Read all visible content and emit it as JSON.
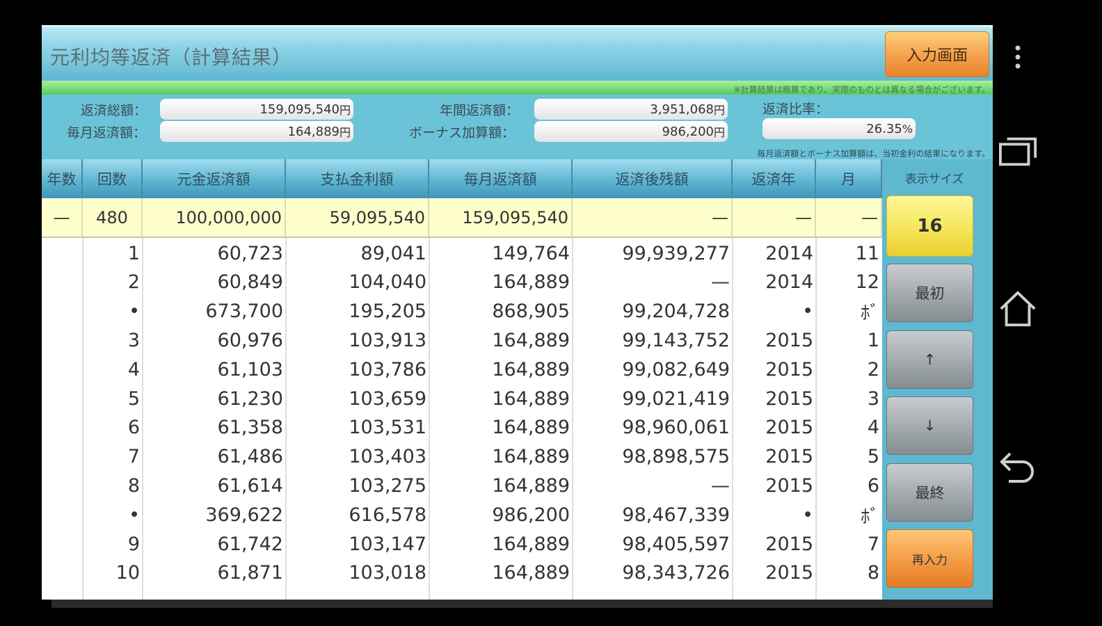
{
  "title": "元利均等返済（計算結果）",
  "input_screen_button": "入力画面",
  "disclaimer": "※計算結果は概算であり、実際のものとは異なる場合がございます。",
  "summary": {
    "total_repayment_label": "返済総額：",
    "total_repayment_value": "159,095,540",
    "monthly_repayment_label": "毎月返済額：",
    "monthly_repayment_value": "164,889",
    "annual_repayment_label": "年間返済額：",
    "annual_repayment_value": "3,951,068",
    "bonus_addition_label": "ボーナス加算額：",
    "bonus_addition_value": "986,200",
    "ratio_label": "返済比率：",
    "ratio_value": "26.35",
    "yen_unit": "円",
    "percent_unit": "%",
    "note": "毎月返済額とボーナス加算額は、当初金利の結果になります。"
  },
  "table": {
    "headers": [
      "年数",
      "回数",
      "元金返済額",
      "支払金利額",
      "毎月返済額",
      "返済後残額",
      "返済年",
      "月"
    ],
    "totals": [
      "—",
      "480",
      "100,000,000",
      "59,095,540",
      "159,095,540",
      "—",
      "—",
      "—"
    ],
    "rows": [
      [
        "",
        "1",
        "60,723",
        "89,041",
        "149,764",
        "99,939,277",
        "2014",
        "11"
      ],
      [
        "",
        "2",
        "60,849",
        "104,040",
        "164,889",
        "—",
        "2014",
        "12"
      ],
      [
        "",
        "•",
        "673,700",
        "195,205",
        "868,905",
        "99,204,728",
        "•",
        "ﾎﾞ"
      ],
      [
        "",
        "3",
        "60,976",
        "103,913",
        "164,889",
        "99,143,752",
        "2015",
        "1"
      ],
      [
        "",
        "4",
        "61,103",
        "103,786",
        "164,889",
        "99,082,649",
        "2015",
        "2"
      ],
      [
        "",
        "5",
        "61,230",
        "103,659",
        "164,889",
        "99,021,419",
        "2015",
        "3"
      ],
      [
        "",
        "6",
        "61,358",
        "103,531",
        "164,889",
        "98,960,061",
        "2015",
        "4"
      ],
      [
        "",
        "7",
        "61,486",
        "103,403",
        "164,889",
        "98,898,575",
        "2015",
        "5"
      ],
      [
        "",
        "8",
        "61,614",
        "103,275",
        "164,889",
        "—",
        "2015",
        "6"
      ],
      [
        "",
        "•",
        "369,622",
        "616,578",
        "986,200",
        "98,467,339",
        "•",
        "ﾎﾞ"
      ],
      [
        "",
        "9",
        "61,742",
        "103,147",
        "164,889",
        "98,405,597",
        "2015",
        "7"
      ],
      [
        "",
        "10",
        "61,871",
        "103,018",
        "164,889",
        "98,343,726",
        "2015",
        "8"
      ]
    ]
  },
  "side": {
    "size_label": "表示サイズ",
    "size_value": "16",
    "first_button": "最初",
    "up_button": "↑",
    "down_button": "↓",
    "last_button": "最終",
    "reenter_button": "再入力"
  },
  "nav_icons": [
    "overflow-menu-icon",
    "recent-apps-icon",
    "home-icon",
    "back-icon"
  ]
}
